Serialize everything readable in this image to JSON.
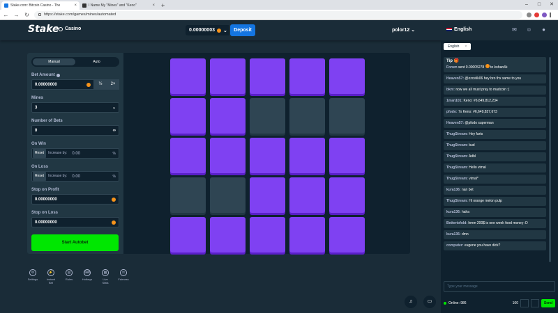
{
  "browser": {
    "tabs": [
      {
        "title": "Stake.com: Bitcoin Casino - The",
        "active": true
      },
      {
        "title": "I Name My \"Mines\" and \"Keno\"",
        "active": false
      }
    ],
    "url": "https://stake.com/games/mines/automated"
  },
  "header": {
    "logo": "Stake",
    "casino_label": "Casino",
    "balance": "0.00000003",
    "deposit_label": "Deposit",
    "username": "polor12",
    "language": "English"
  },
  "sidebar": {
    "tabs": [
      "Manual",
      "Auto"
    ],
    "bet_amount_label": "Bet Amount",
    "bet_amount": "0.00000000",
    "half_label": "½",
    "double_label": "2×",
    "mines_label": "Mines",
    "mines_value": "3",
    "num_bets_label": "Number of Bets",
    "num_bets_value": "0",
    "infinity": "∞",
    "on_win_label": "On Win",
    "on_loss_label": "On Loss",
    "reset_label": "Reset",
    "increase_label": "Increase by:",
    "on_win_value": "0.00",
    "on_loss_value": "0.00",
    "percent": "%",
    "stop_profit_label": "Stop on Profit",
    "stop_profit_value": "0.00000000",
    "stop_loss_label": "Stop on Loss",
    "stop_loss_value": "0.00000000",
    "start_label": "Start Autobet"
  },
  "grid": {
    "tiles": [
      1,
      1,
      1,
      1,
      1,
      1,
      1,
      0,
      0,
      0,
      1,
      1,
      1,
      1,
      1,
      0,
      0,
      1,
      1,
      1,
      1,
      1,
      1,
      1,
      1
    ]
  },
  "footer_icons": [
    {
      "label": "Settings",
      "glyph": "⚙"
    },
    {
      "label": "Instant Bet",
      "glyph": "⚡"
    },
    {
      "label": "Rules",
      "glyph": "▤"
    },
    {
      "label": "Hotkeys",
      "glyph": "⌨"
    },
    {
      "label": "Live Stats",
      "glyph": "▦"
    },
    {
      "label": "Fairness",
      "glyph": "⚖"
    }
  ],
  "chat": {
    "tab_label": "English",
    "tip_title": "Tip",
    "tip_text": {
      "name": "Forum",
      "rest": "sent 0.00005278",
      "to": "to kohan4k"
    },
    "messages": [
      {
        "name": "Heaven57:",
        "text": "@ozcelik06 hey bro thx same to you"
      },
      {
        "name": "bkm:",
        "text": "now we all must pray to madcoin :("
      },
      {
        "name": "1man101:",
        "text": "Keno: #6,649,812,234"
      },
      {
        "name": "pfodo:",
        "text": "7x Keno: #6,649,827,673"
      },
      {
        "name": "Heaven57:",
        "text": "@pfodo superman"
      },
      {
        "name": "ThugStream:",
        "text": "Hey farts"
      },
      {
        "name": "ThugStream:",
        "text": "bud"
      },
      {
        "name": "ThugStream:",
        "text": "Adbl"
      },
      {
        "name": "ThugStream:",
        "text": "Hello vimal"
      },
      {
        "name": "ThugStream:",
        "text": "vimal*"
      },
      {
        "name": "kura136:",
        "text": "nan bet"
      },
      {
        "name": "ThugStream:",
        "text": "Hi orange melon pulp"
      },
      {
        "name": "kura136:",
        "text": "haha"
      },
      {
        "name": "Bettertofold:",
        "text": "hmm 200$ is one week food money :D"
      },
      {
        "name": "kura136:",
        "text": "dmn"
      },
      {
        "name": "computer:",
        "text": "eugene you have dick?"
      }
    ],
    "input_placeholder": "Type your message",
    "online_label": "Online: 986",
    "count": "160",
    "send_label": "Send"
  }
}
